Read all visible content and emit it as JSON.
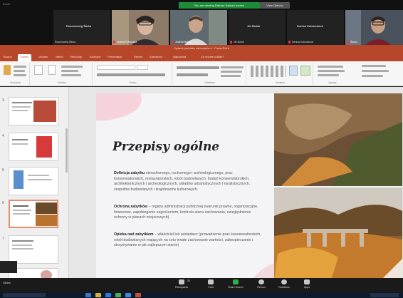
{
  "zoom": {
    "window_title": "Zoom",
    "share_banner": "You are viewing Dariusz Kalisz's screen",
    "stop_button": "View Options",
    "participants": [
      {
        "name": "Rosenzweig Šárka",
        "sub": "Rosenzweig Šárka"
      },
      {
        "name": "",
        "sub": "Jolanta Pytlowska"
      },
      {
        "name": "",
        "sub": "Jindřich Balcar"
      },
      {
        "name": "Jiří Bubík",
        "sub": "Jiří Bubík"
      },
      {
        "name": "Denisa Kalousková",
        "sub": "Denisa Kalousková"
      },
      {
        "name": "",
        "sub": "Šimon"
      }
    ],
    "toolbar": {
      "participants": "Participants",
      "participants_count": "53",
      "chat": "Chat",
      "share": "Share Screen",
      "record": "Record",
      "reactions": "Reactions",
      "apps": "Apps"
    },
    "leave": "Slides"
  },
  "ppt": {
    "title": "Vydané památky zabezpečení - PowerPoint",
    "tabs": [
      "Soubor",
      "Domů",
      "Vložení",
      "Návrh",
      "Přechody",
      "Animace",
      "Prezentace",
      "Revize",
      "Zobrazení",
      "Nápověda",
      "Co chcete udělat?"
    ],
    "ribbon_groups": [
      "Schránka",
      "Snímky",
      "Písmo",
      "Odstavec",
      "Kreslení",
      "Úpravy"
    ],
    "slide_numbers": [
      "3",
      "4",
      "5",
      "6",
      "7"
    ],
    "slide": {
      "title": "Przepisy ogólne",
      "paragraphs": [
        {
          "bold": "Definicja zabytku",
          "text": " nieruchomego, ruchomego i archeologicznego, prac konserwatorskich, restauratorskich, robót budowlanych, badań konserwatorskich, architektonicznych i archeologicznych, układów urbanistycznych i ruralistycznych, zespołów budowlanych i krajobrazów kulturowych."
        },
        {
          "bold": "Ochrona zabytków",
          "text": " – organy administracji publicznej (warunki prawne, organizacyjne, finansowe, zapobieganie zagrożeniom, kontrola stanu zachowania, uwzględnienie ochrony w planach miejscowych)."
        },
        {
          "bold": "Opieka nad zabytkiem",
          "text": " – właściciel lub posiadacz (prowadzenie prac konserwatorskich, robót budowlanych mających na celu trwałe zachowanie wartości, zabezpieczanie i utrzymywanie w jak najlepszym stanie)"
        }
      ]
    }
  }
}
